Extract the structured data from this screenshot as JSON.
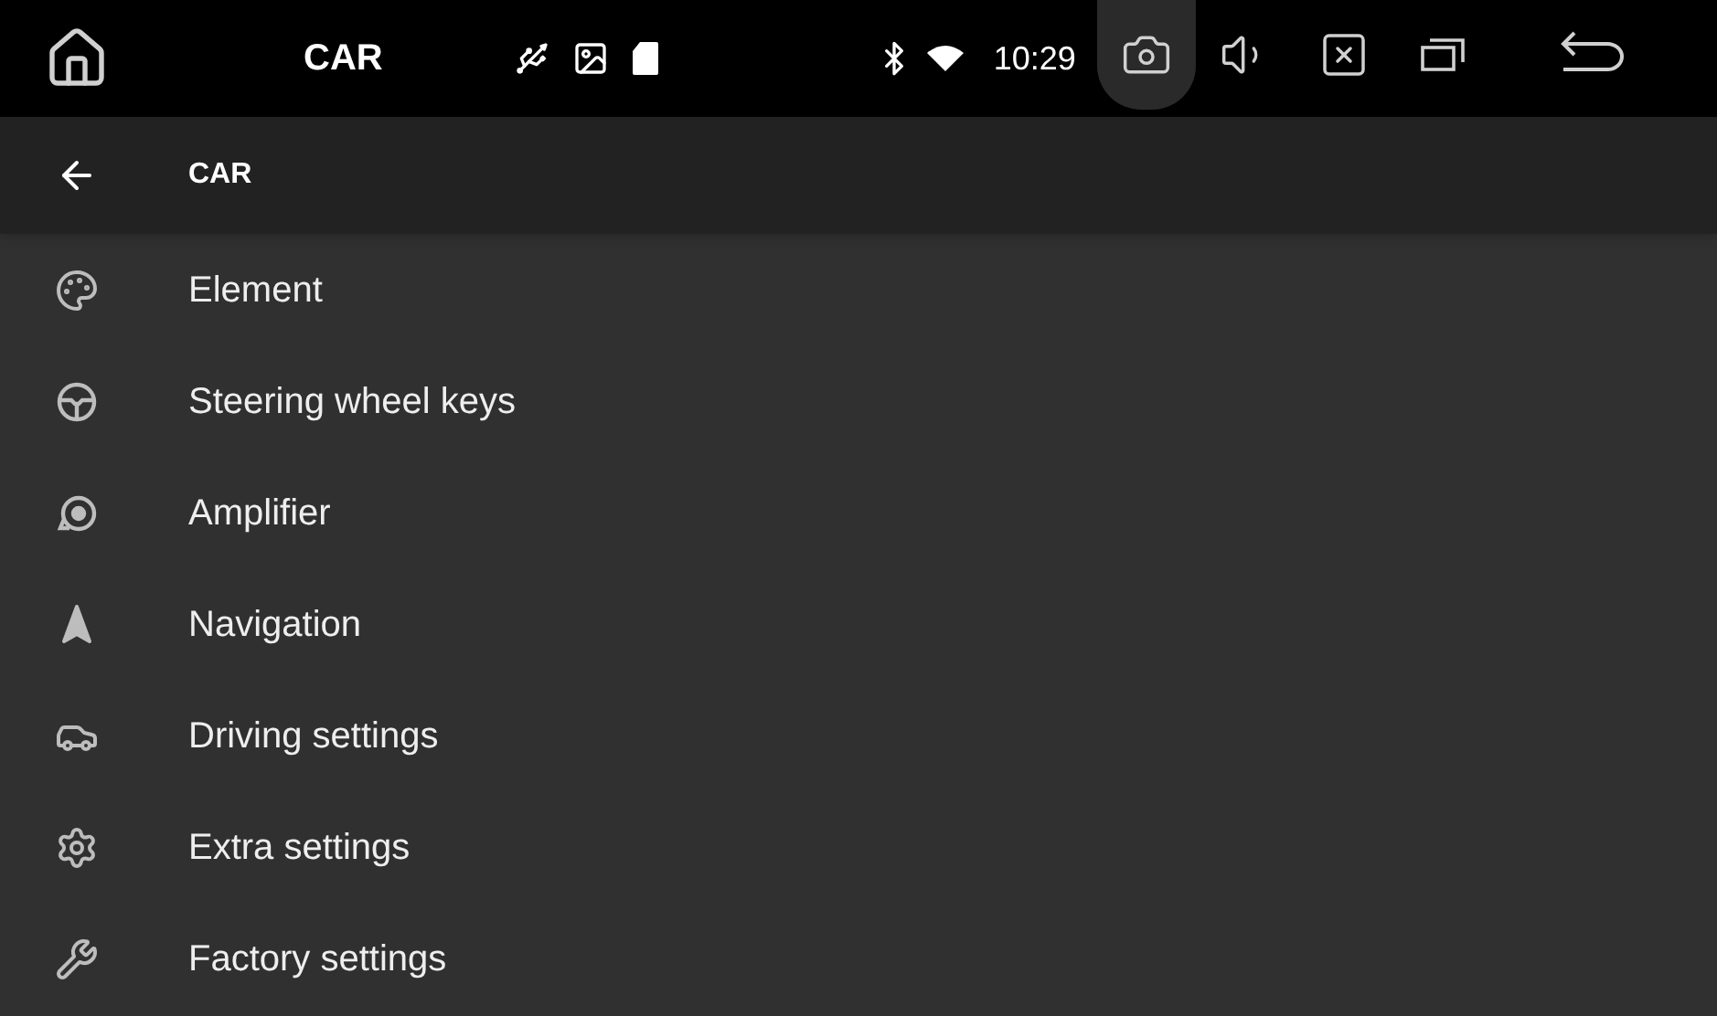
{
  "status_bar": {
    "app_title": "CAR",
    "time": "10:29",
    "buttons": [
      {
        "kind": "screenshot",
        "selected": true
      },
      {
        "kind": "volume",
        "selected": false
      },
      {
        "kind": "close",
        "selected": false
      },
      {
        "kind": "recents",
        "selected": false
      },
      {
        "kind": "back",
        "selected": false
      }
    ]
  },
  "header": {
    "title": "CAR"
  },
  "items": [
    {
      "label": "Element",
      "kind": "palette"
    },
    {
      "label": "Steering wheel keys",
      "kind": "steering"
    },
    {
      "label": "Amplifier",
      "kind": "speaker"
    },
    {
      "label": "Navigation",
      "kind": "navigation"
    },
    {
      "label": "Driving settings",
      "kind": "car"
    },
    {
      "label": "Extra settings",
      "kind": "gears"
    },
    {
      "label": "Factory settings",
      "kind": "tools"
    }
  ]
}
